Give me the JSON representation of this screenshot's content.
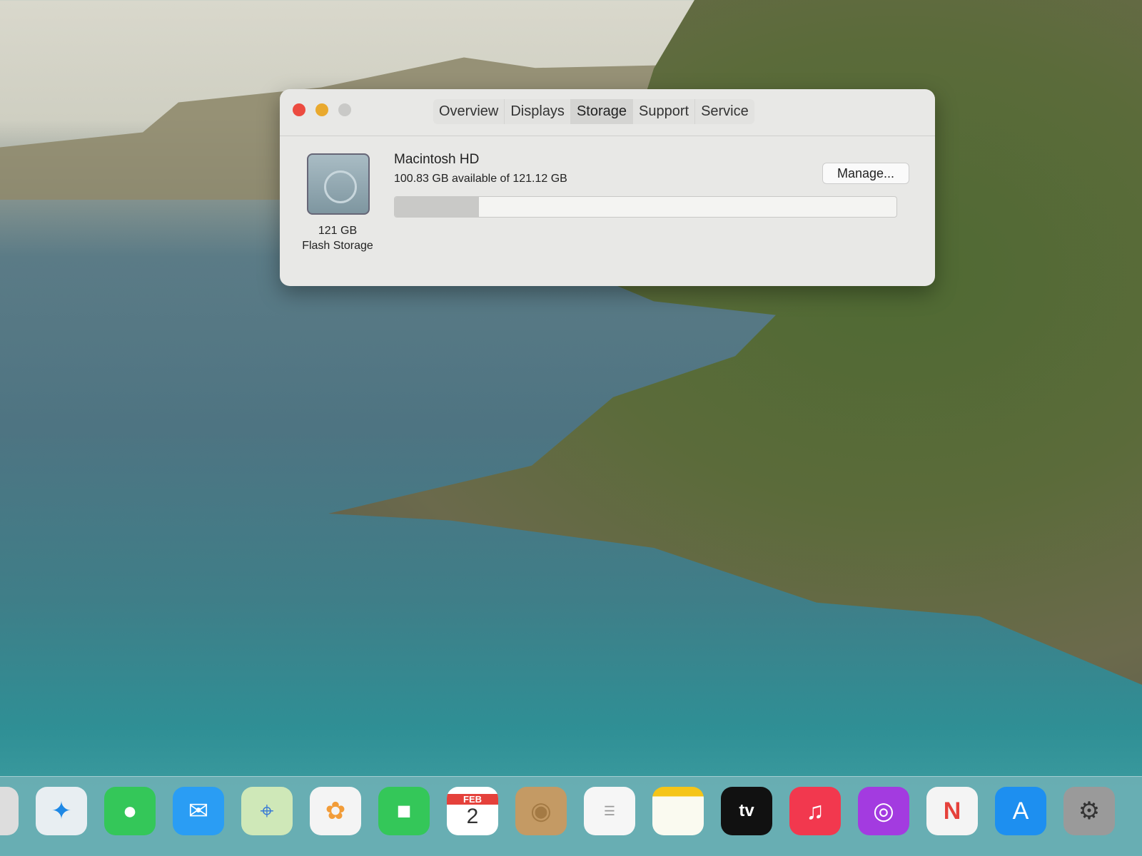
{
  "window": {
    "tabs": [
      "Overview",
      "Displays",
      "Storage",
      "Support",
      "Service"
    ],
    "active_tab": "Storage",
    "disk_size": "121 GB",
    "disk_type": "Flash Storage",
    "volume_name": "Macintosh HD",
    "availability": "100.83 GB available of 121.12 GB",
    "used_fraction": 0.1675,
    "manage_label": "Manage..."
  },
  "dock": {
    "calendar_month": "FEB",
    "calendar_day": "2",
    "tv_label": "tv",
    "items": [
      "Launchpad",
      "Safari",
      "Messages",
      "Mail",
      "Maps",
      "Photos",
      "FaceTime",
      "Calendar",
      "Contacts",
      "Reminders",
      "Notes",
      "TV",
      "Music",
      "Podcasts",
      "News",
      "App Store",
      "System Settings"
    ]
  }
}
